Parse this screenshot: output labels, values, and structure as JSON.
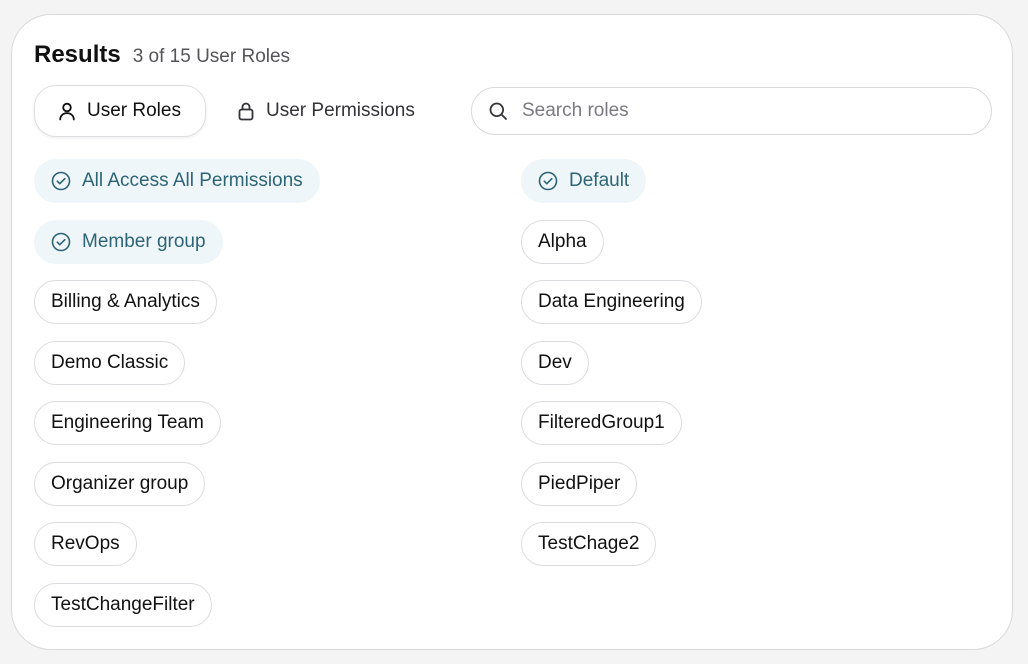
{
  "header": {
    "title": "Results",
    "subtitle": "3 of 15 User Roles"
  },
  "tabs": [
    {
      "label": "User Roles",
      "icon": "user-icon",
      "active": true
    },
    {
      "label": "User Permissions",
      "icon": "lock-icon",
      "active": false
    }
  ],
  "search": {
    "placeholder": "Search roles",
    "value": ""
  },
  "colors": {
    "selected_text": "#2e6475",
    "selected_bg": "#eef6f9",
    "chip_border": "#dcdce0"
  },
  "roles_left": [
    {
      "label": "All Access All Permissions",
      "selected": true
    },
    {
      "label": "Member group",
      "selected": true
    },
    {
      "label": "Billing & Analytics",
      "selected": false
    },
    {
      "label": "Demo Classic",
      "selected": false
    },
    {
      "label": "Engineering Team",
      "selected": false
    },
    {
      "label": "Organizer group",
      "selected": false
    },
    {
      "label": "RevOps",
      "selected": false
    },
    {
      "label": "TestChangeFilter",
      "selected": false
    }
  ],
  "roles_right": [
    {
      "label": "Default",
      "selected": true
    },
    {
      "label": "Alpha",
      "selected": false
    },
    {
      "label": "Data Engineering",
      "selected": false
    },
    {
      "label": "Dev",
      "selected": false
    },
    {
      "label": "FilteredGroup1",
      "selected": false
    },
    {
      "label": "PiedPiper",
      "selected": false
    },
    {
      "label": "TestChage2",
      "selected": false
    }
  ]
}
